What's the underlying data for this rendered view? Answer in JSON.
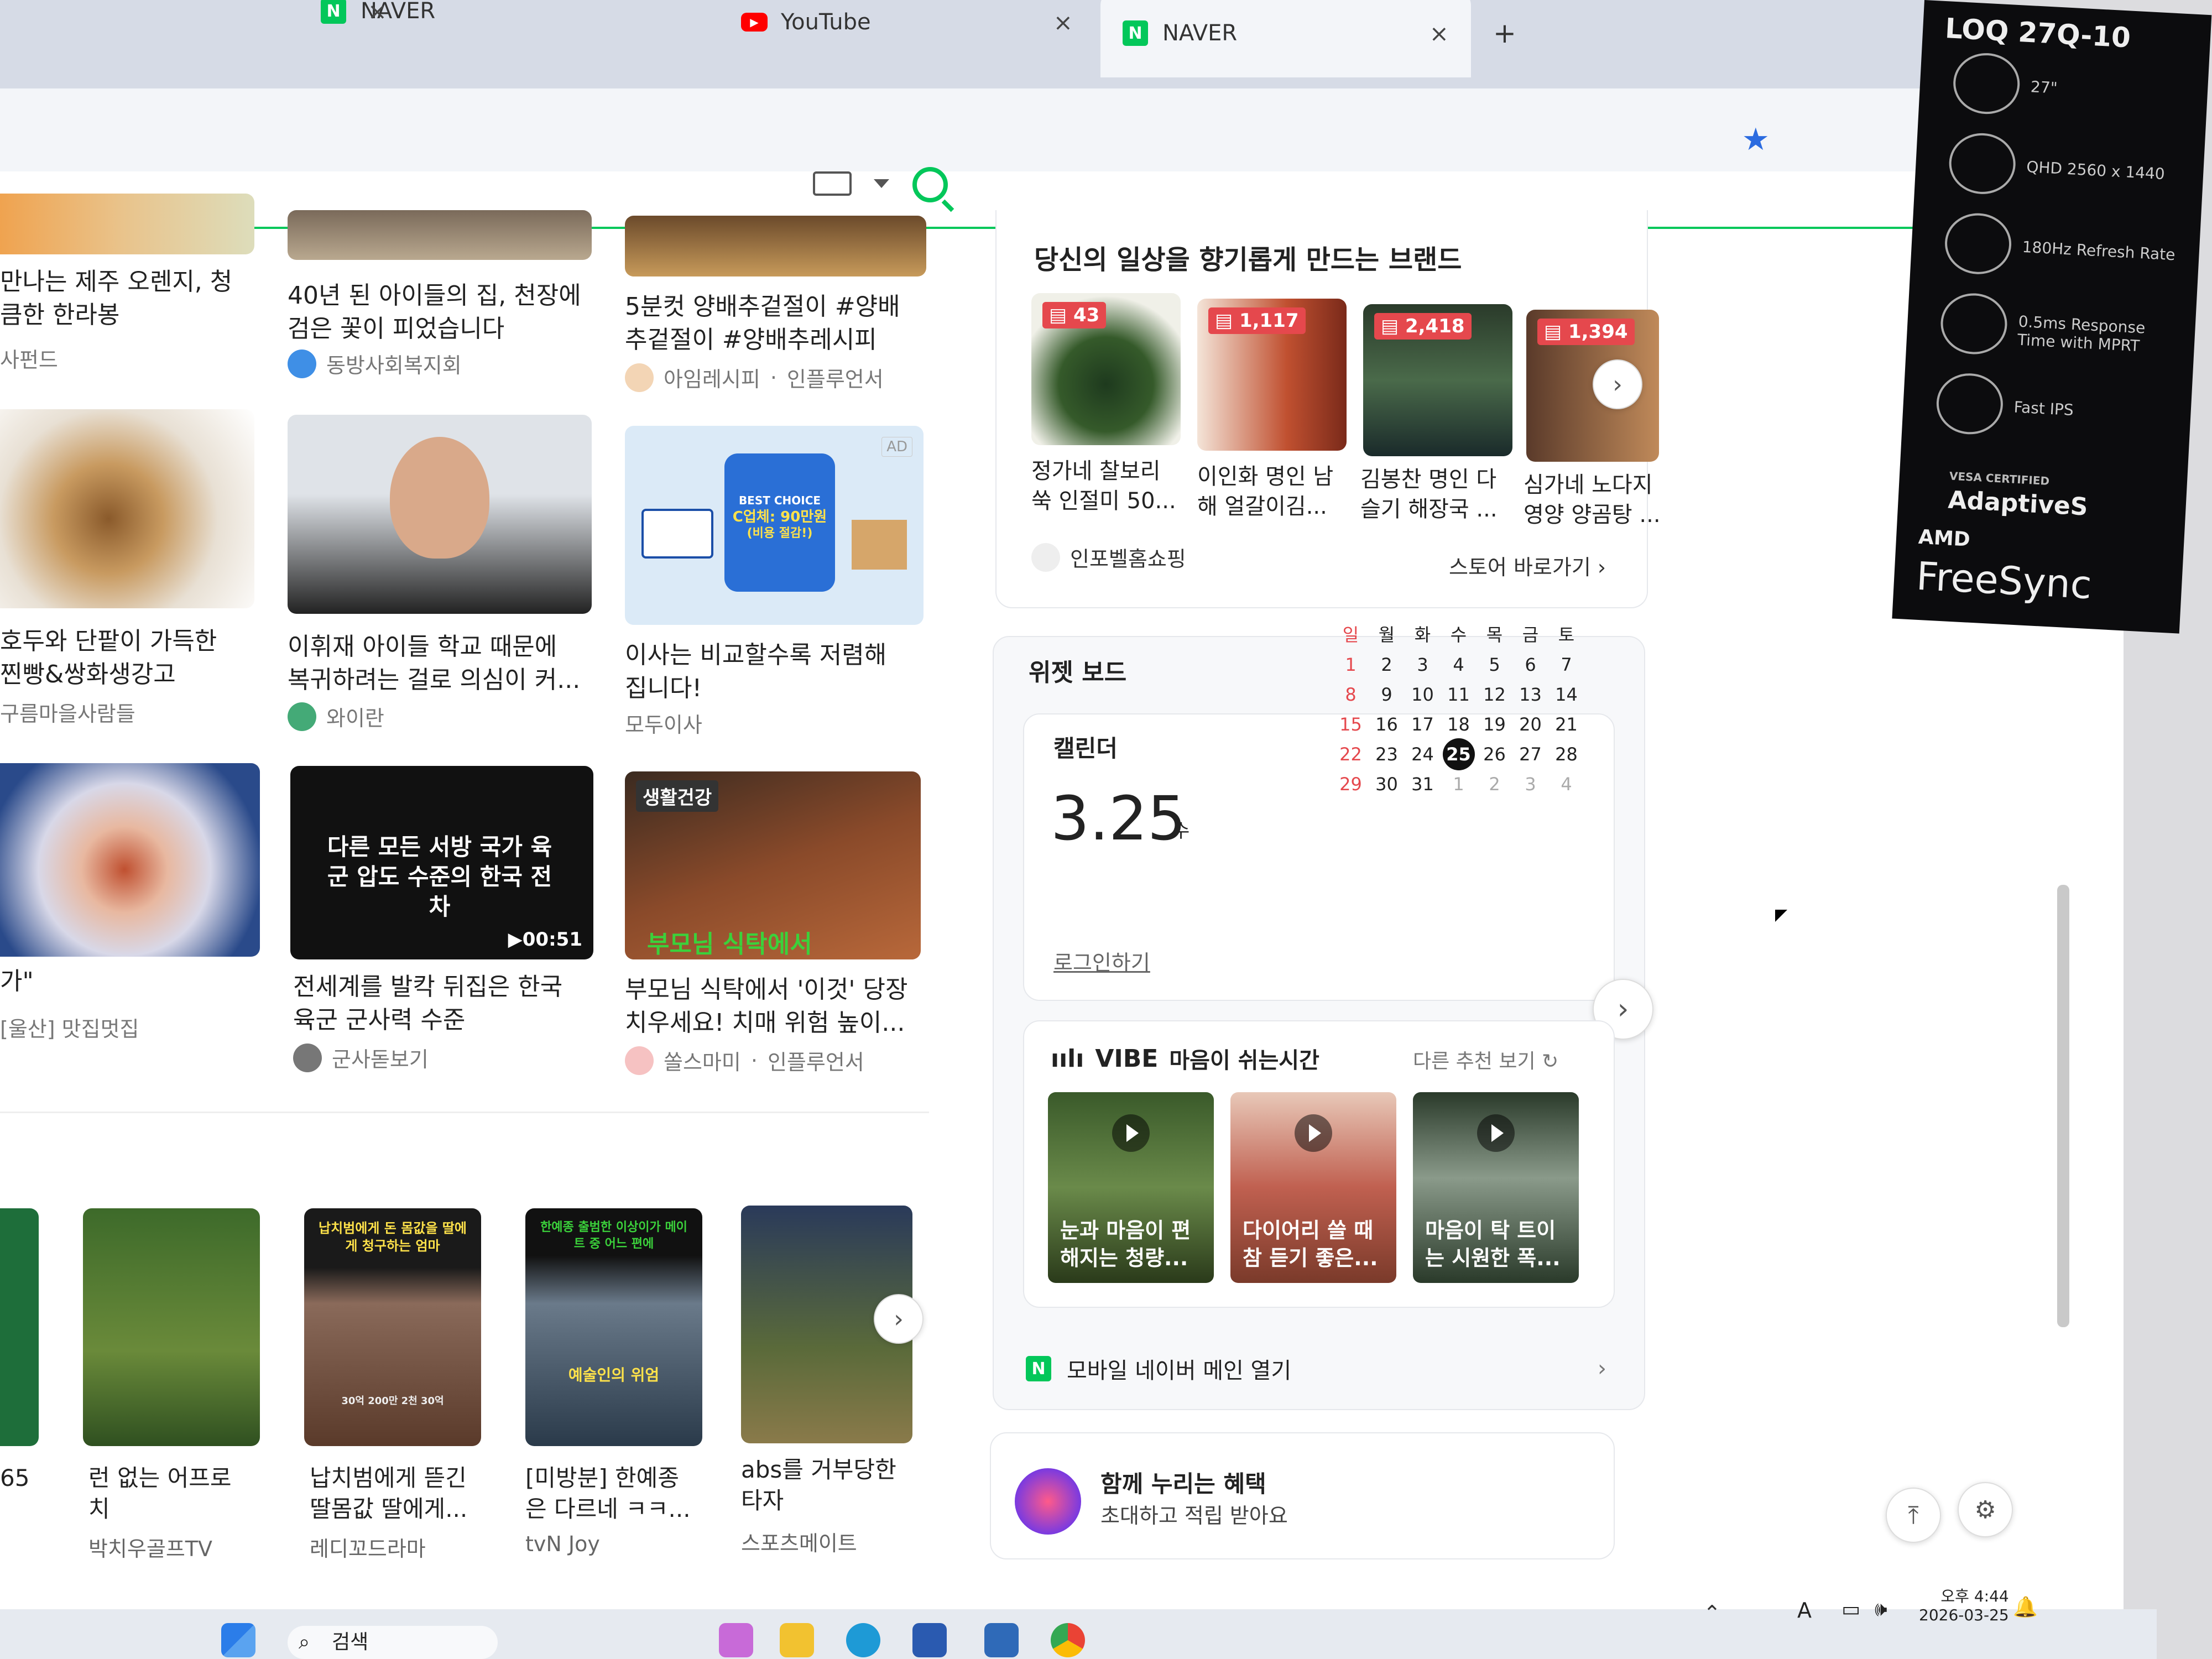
{
  "browser": {
    "tabs": [
      {
        "label": "NAVER",
        "active": false
      },
      {
        "label": "YouTube",
        "active": false
      },
      {
        "label": "NAVER",
        "active": true
      }
    ],
    "new_tab": "+",
    "bookmark_icon": "star-icon"
  },
  "feed": {
    "row1": [
      {
        "title_1": "만나는 제주 오렌지, 청",
        "title_2": "큼한 한라봉",
        "source": "사펀드"
      },
      {
        "title_1": "40년 된 아이들의 집, 천장에",
        "title_2": "검은 꽃이 피었습니다",
        "source": "동방사회복지회"
      },
      {
        "title_1": "5분컷 양배추겉절이 #양배",
        "title_2": "추겉절이 #양배추레시피",
        "source": "아임레시피",
        "tag": "인플루언서"
      }
    ],
    "row2": [
      {
        "title_1": "호두와 단팥이 가득한",
        "title_2": "찐빵&쌍화생강고",
        "source": "구름마을사람들"
      },
      {
        "title_1": "이휘재 아이들 학교 때문에",
        "title_2": "복귀하려는 걸로 의심이 커...",
        "source": "와이란"
      },
      {
        "title_1": "이사는 비교할수록 저렴해",
        "title_2": "집니다!",
        "source": "모두이사",
        "ad": "AD",
        "thumb_text_1": "BEST CHOICE",
        "thumb_text_2": "C업체: 90만원",
        "thumb_text_3": "(비용 절감!)"
      }
    ],
    "row3": [
      {
        "title_1": "가\"",
        "title_2": "",
        "source": "[울산] 맛집멋집"
      },
      {
        "title_1": "전세계를 발칵 뒤집은 한국",
        "title_2": "육군 군사력 수준",
        "source": "군사돋보기",
        "thumb_text": "다른 모든 서방 국가 육군 압도 수준의 한국 전차",
        "duration": "▶00:51"
      },
      {
        "title_1": "부모님 식탁에서 '이것' 당장",
        "title_2": "치우세요! 치매 위험 높이...",
        "source": "쏠스마미",
        "tag": "인플루언서",
        "badge": "생활건강",
        "thumb_caption": "부모님 식탁에서"
      }
    ]
  },
  "shorts": [
    {
      "title_1": "",
      "title_2": "",
      "count": "65"
    },
    {
      "title_1": "런 없는 어프로",
      "title_2": "치",
      "source": "박치우골프TV"
    },
    {
      "title_1": "납치범에게 뜯긴",
      "title_2": "딸몸값 딸에게...",
      "source": "레디꼬드라마",
      "thumb_text": "납치범에게 돈 몸값을 딸에게 청구하는 엄마",
      "thumb_sub": "30억 200만 2천 30억"
    },
    {
      "title_1": "[미방분] 한예종",
      "title_2": "은 다르네 ㅋㅋ...",
      "source": "tvN Joy",
      "thumb_text": "한예종 출범한 이상이가 메이트 중 어느 편에",
      "thumb_sub": "예술인의 위엄"
    },
    {
      "title_1": "abs를 거부당한",
      "title_2": "타자",
      "source": "스포츠메이트"
    }
  ],
  "brands": {
    "heading": "당신의 일상을 향기롭게 만드는 브랜드",
    "items": [
      {
        "count": "43",
        "title_1": "정가네 찰보리",
        "title_2": "쑥 인절미 50..."
      },
      {
        "count": "1,117",
        "title_1": "이인화 명인 남",
        "title_2": "해 얼갈이김..."
      },
      {
        "count": "2,418",
        "title_1": "김봉찬 명인 다",
        "title_2": "슬기 해장국 ..."
      },
      {
        "count": "1,394",
        "title_1": "심가네 노다지",
        "title_2": "영양 양곰탕 ..."
      }
    ],
    "store_name": "인포벨홈쇼핑",
    "store_link": "스토어 바로가기 ›"
  },
  "widget": {
    "heading": "위젯 보드",
    "calendar_label": "캘린더",
    "date": "3.25",
    "weekday": "수",
    "login": "로그인하기",
    "dow": [
      "일",
      "월",
      "화",
      "수",
      "목",
      "금",
      "토"
    ],
    "weeks": [
      [
        "1",
        "2",
        "3",
        "4",
        "5",
        "6",
        "7"
      ],
      [
        "8",
        "9",
        "10",
        "11",
        "12",
        "13",
        "14"
      ],
      [
        "15",
        "16",
        "17",
        "18",
        "19",
        "20",
        "21"
      ],
      [
        "22",
        "23",
        "24",
        "25",
        "26",
        "27",
        "28"
      ],
      [
        "29",
        "30",
        "31",
        "1",
        "2",
        "3",
        "4"
      ]
    ],
    "today": "25"
  },
  "vibe": {
    "logo": "VIBE",
    "title": "마음이 쉬는시간",
    "more": "다른 추천 보기",
    "videos": [
      {
        "cap_1": "눈과 마음이 편",
        "cap_2": "해지는 청량..."
      },
      {
        "cap_1": "다이어리 쓸 때",
        "cap_2": "참 듣기 좋은..."
      },
      {
        "cap_1": "마음이 탁 트이",
        "cap_2": "는 시원한 폭..."
      }
    ]
  },
  "mobile_link": "모바일 네이버 메인 열기",
  "benefit": {
    "title": "함께 누리는 혜택",
    "subtitle": "초대하고 적립 받아요"
  },
  "monitor_sticker": {
    "model": "LOQ 27Q-10",
    "specs": [
      "27\"",
      "QHD 2560 x 1440",
      "180Hz Refresh Rate",
      "0.5ms Response Time with MPRT",
      "Fast IPS"
    ],
    "vesa": "VESA CERTIFIED",
    "adaptive": "AdaptiveS",
    "amd": "AMD",
    "freesync": "FreeSync"
  },
  "taskbar": {
    "search": "검색",
    "time": "오후 4:44",
    "date": "2026-03-25",
    "ime": "A"
  },
  "colors": {
    "naver_green": "#03c75a",
    "badge_red": "#e5484d"
  }
}
